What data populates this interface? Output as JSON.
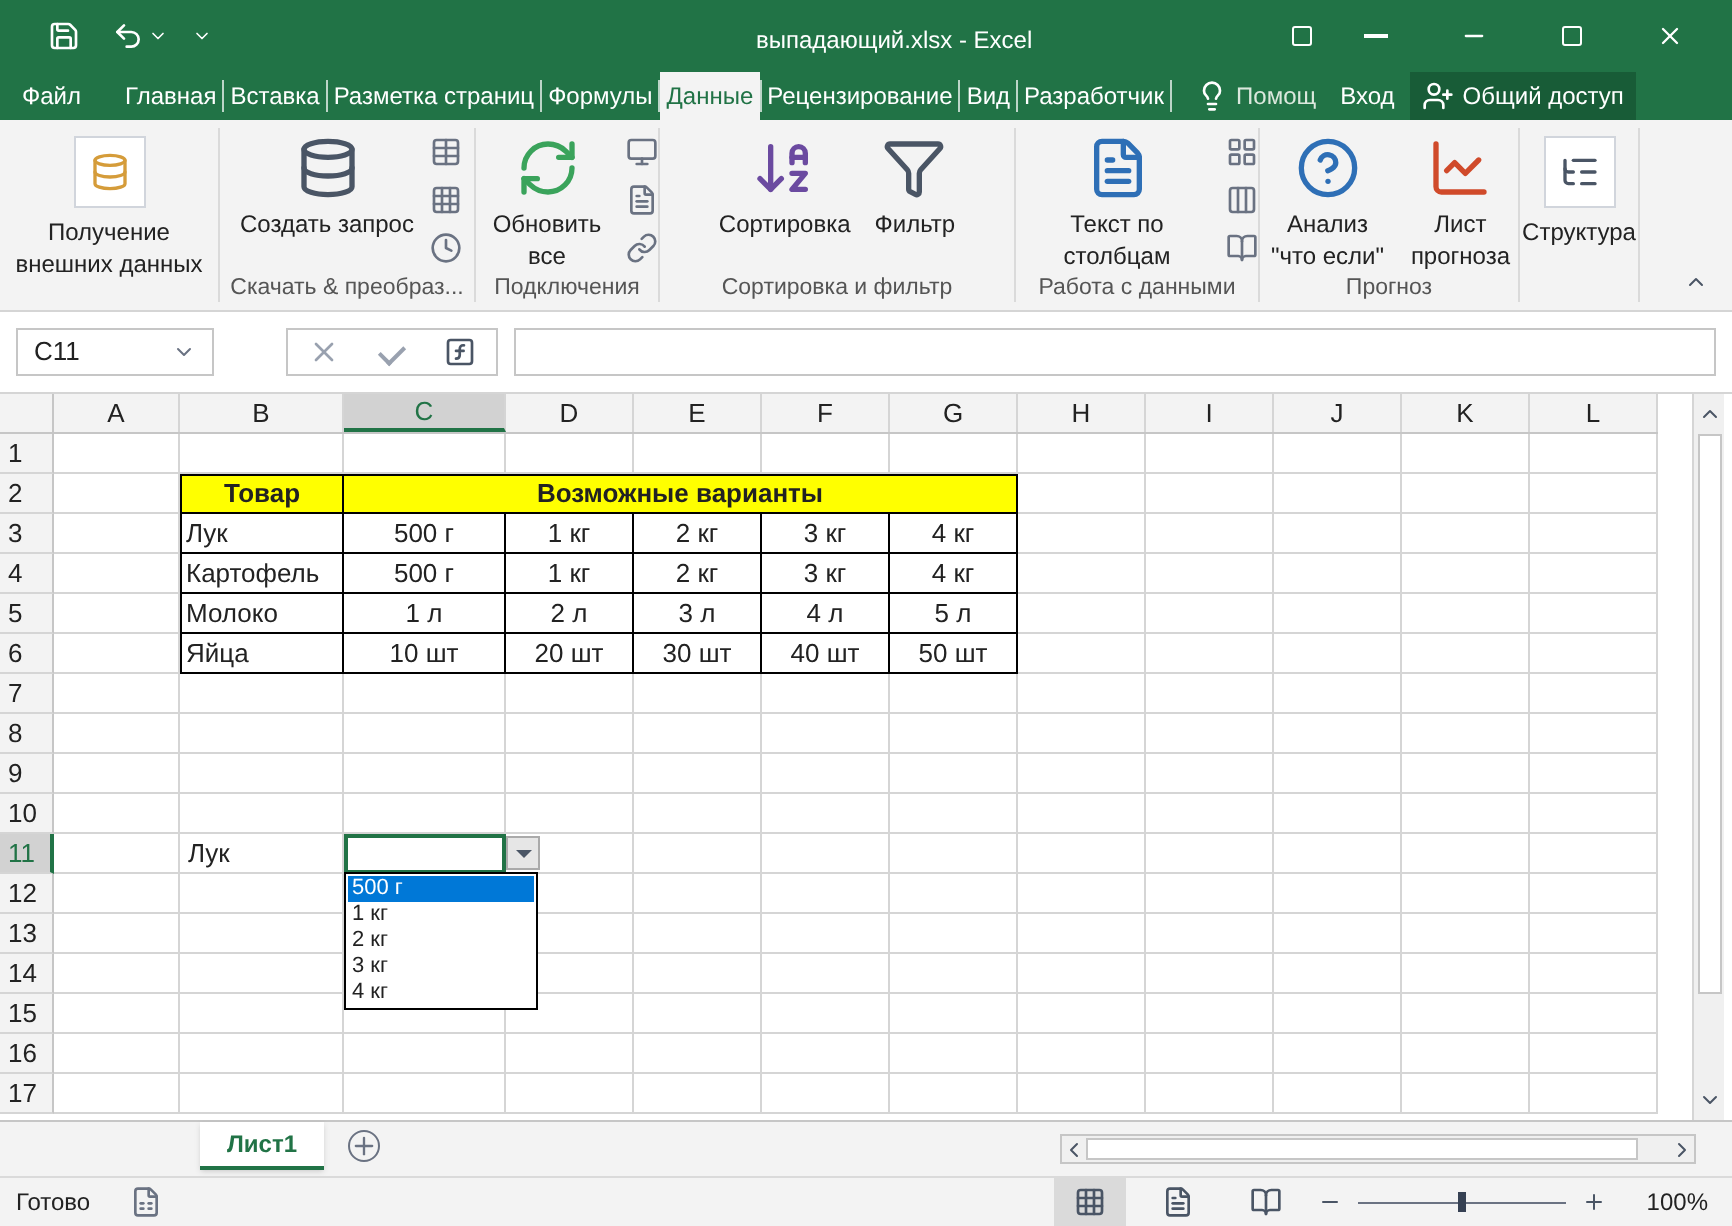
{
  "window": {
    "title": "выпадающий.xlsx - Excel"
  },
  "tabs": [
    {
      "label": "Файл",
      "selected": false
    },
    {
      "label": "Главная",
      "selected": false
    },
    {
      "label": "Вставка",
      "selected": false
    },
    {
      "label": "Разметка страниц",
      "selected": false
    },
    {
      "label": "Формулы",
      "selected": false
    },
    {
      "label": "Данные",
      "selected": true
    },
    {
      "label": "Рецензирование",
      "selected": false
    },
    {
      "label": "Вид",
      "selected": false
    },
    {
      "label": "Разработчик",
      "selected": false
    }
  ],
  "help": "Помощ",
  "sign_in": "Вход",
  "share": "Общий доступ",
  "ribbon_groups": [
    {
      "buttons": [
        {
          "label": "Получение внешних данных",
          "kind": "data"
        }
      ]
    },
    {
      "label": "Скачать & преобраз...",
      "buttons": [
        {
          "label": "Создать запрос",
          "kind": "query"
        }
      ]
    },
    {
      "label": "Подключения",
      "buttons": [
        {
          "label": "Обновить все",
          "kind": "refresh"
        }
      ]
    },
    {
      "label": "Сортировка и фильтр",
      "buttons": [
        {
          "label": "Сортировка",
          "kind": "sort"
        },
        {
          "label": "Фильтр",
          "kind": "filter"
        }
      ]
    },
    {
      "label": "Работа с данными",
      "buttons": [
        {
          "label": "Текст по столбцам",
          "kind": "text"
        }
      ]
    },
    {
      "label": "Прогноз",
      "buttons": [
        {
          "label": "Анализ \"что если\"",
          "kind": "whatif"
        },
        {
          "label": "Лист прогноза",
          "kind": "forecast"
        }
      ]
    },
    {
      "buttons": [
        {
          "label": "Структура",
          "kind": "outline"
        }
      ]
    }
  ],
  "name_box": "C11",
  "column_headers": [
    {
      "label": "A",
      "selected": false
    },
    {
      "label": "B",
      "selected": false
    },
    {
      "label": "C",
      "selected": true
    },
    {
      "label": "D",
      "selected": false
    },
    {
      "label": "E",
      "selected": false
    },
    {
      "label": "F",
      "selected": false
    },
    {
      "label": "G",
      "selected": false
    },
    {
      "label": "H",
      "selected": false
    },
    {
      "label": "I",
      "selected": false
    },
    {
      "label": "J",
      "selected": false
    },
    {
      "label": "K",
      "selected": false
    },
    {
      "label": "L",
      "selected": false
    }
  ],
  "row_headers": [
    {
      "label": "1",
      "selected": false
    },
    {
      "label": "2",
      "selected": false
    },
    {
      "label": "3",
      "selected": false
    },
    {
      "label": "4",
      "selected": false
    },
    {
      "label": "5",
      "selected": false
    },
    {
      "label": "6",
      "selected": false
    },
    {
      "label": "7",
      "selected": false
    },
    {
      "label": "8",
      "selected": false
    },
    {
      "label": "9",
      "selected": false
    },
    {
      "label": "10",
      "selected": false
    },
    {
      "label": "11",
      "selected": true
    },
    {
      "label": "12",
      "selected": false
    },
    {
      "label": "13",
      "selected": false
    },
    {
      "label": "14",
      "selected": false
    },
    {
      "label": "15",
      "selected": false
    },
    {
      "label": "16",
      "selected": false
    },
    {
      "label": "17",
      "selected": false
    }
  ],
  "table": {
    "header": [
      "Товар",
      "Возможные варианты"
    ],
    "rows": [
      [
        "Лук",
        "500 г",
        "1 кг",
        "2 кг",
        "3 кг",
        "4 кг"
      ],
      [
        "Картофель",
        "500 г",
        "1 кг",
        "2 кг",
        "3 кг",
        "4 кг"
      ],
      [
        "Молоко",
        "1 л",
        "2 л",
        "3 л",
        "4 л",
        "5 л"
      ],
      [
        "Яйца",
        "10 шт",
        "20 шт",
        "30 шт",
        "40 шт",
        "50 шт"
      ]
    ]
  },
  "lookup_label": "Лук",
  "dropdown": {
    "options": [
      {
        "label": "500 г",
        "selected": true
      },
      {
        "label": "1 кг",
        "selected": false
      },
      {
        "label": "2 кг",
        "selected": false
      },
      {
        "label": "3 кг",
        "selected": false
      },
      {
        "label": "4 кг",
        "selected": false
      }
    ]
  },
  "sheet_tabs": [
    {
      "label": "Лист1",
      "selected": true
    }
  ],
  "status": "Готово",
  "zoom": {
    "level": 0.5,
    "reading": "100%"
  }
}
